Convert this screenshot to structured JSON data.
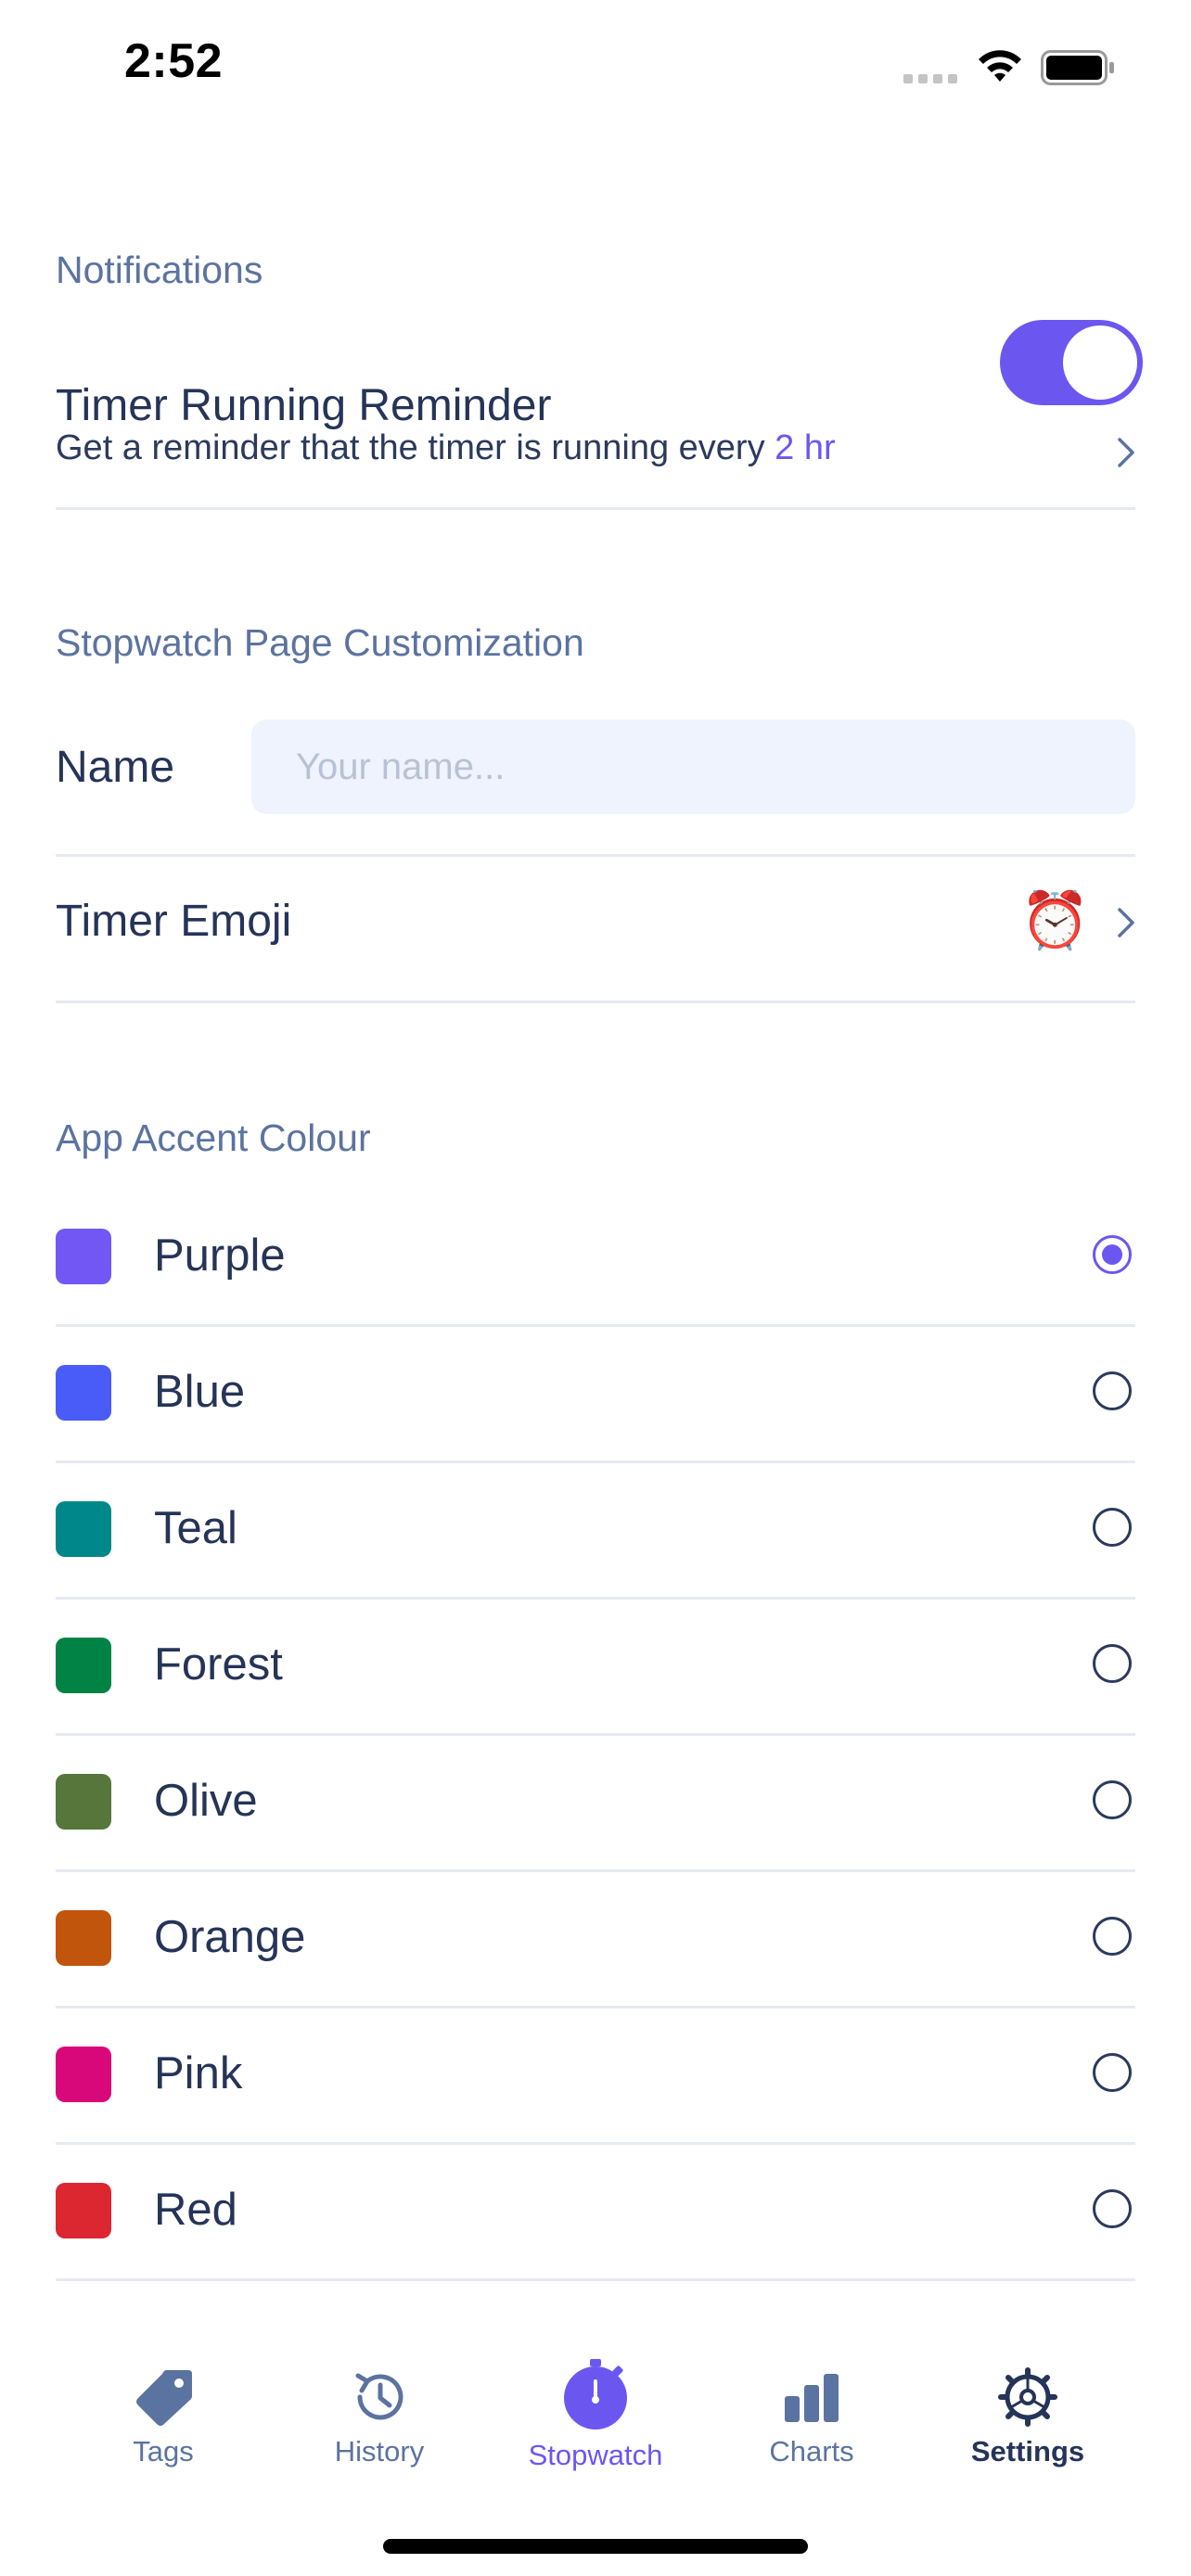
{
  "status_bar": {
    "time": "2:52"
  },
  "notifications": {
    "section_title": "Notifications",
    "reminder_title": "Timer Running Reminder",
    "reminder_enabled": true,
    "reminder_subtext": "Get a reminder that the timer is running every ",
    "reminder_interval": "2 hr"
  },
  "customization": {
    "section_title": "Stopwatch Page Customization",
    "name_label": "Name",
    "name_value": "",
    "name_placeholder": "Your name...",
    "emoji_label": "Timer Emoji",
    "emoji_value": "⏰"
  },
  "accent": {
    "section_title": "App Accent Colour",
    "selected": "Purple",
    "options": [
      {
        "label": "Purple",
        "color": "#7357f5"
      },
      {
        "label": "Blue",
        "color": "#4a5cf8"
      },
      {
        "label": "Teal",
        "color": "#00878a"
      },
      {
        "label": "Forest",
        "color": "#008345"
      },
      {
        "label": "Olive",
        "color": "#56763b"
      },
      {
        "label": "Orange",
        "color": "#c1550c"
      },
      {
        "label": "Pink",
        "color": "#d9087a"
      },
      {
        "label": "Red",
        "color": "#dc2630"
      }
    ]
  },
  "tab_bar": {
    "tabs": [
      {
        "label": "Tags",
        "icon": "tag-icon"
      },
      {
        "label": "History",
        "icon": "history-icon"
      },
      {
        "label": "Stopwatch",
        "icon": "stopwatch-icon"
      },
      {
        "label": "Charts",
        "icon": "chart-icon"
      },
      {
        "label": "Settings",
        "icon": "gear-icon"
      }
    ],
    "current": "Settings"
  },
  "colors": {
    "accent": "#6b57f0",
    "section_title": "#5b73a0",
    "text": "#253457",
    "divider": "#e6e9ef",
    "input_bg": "#eef3fd"
  }
}
